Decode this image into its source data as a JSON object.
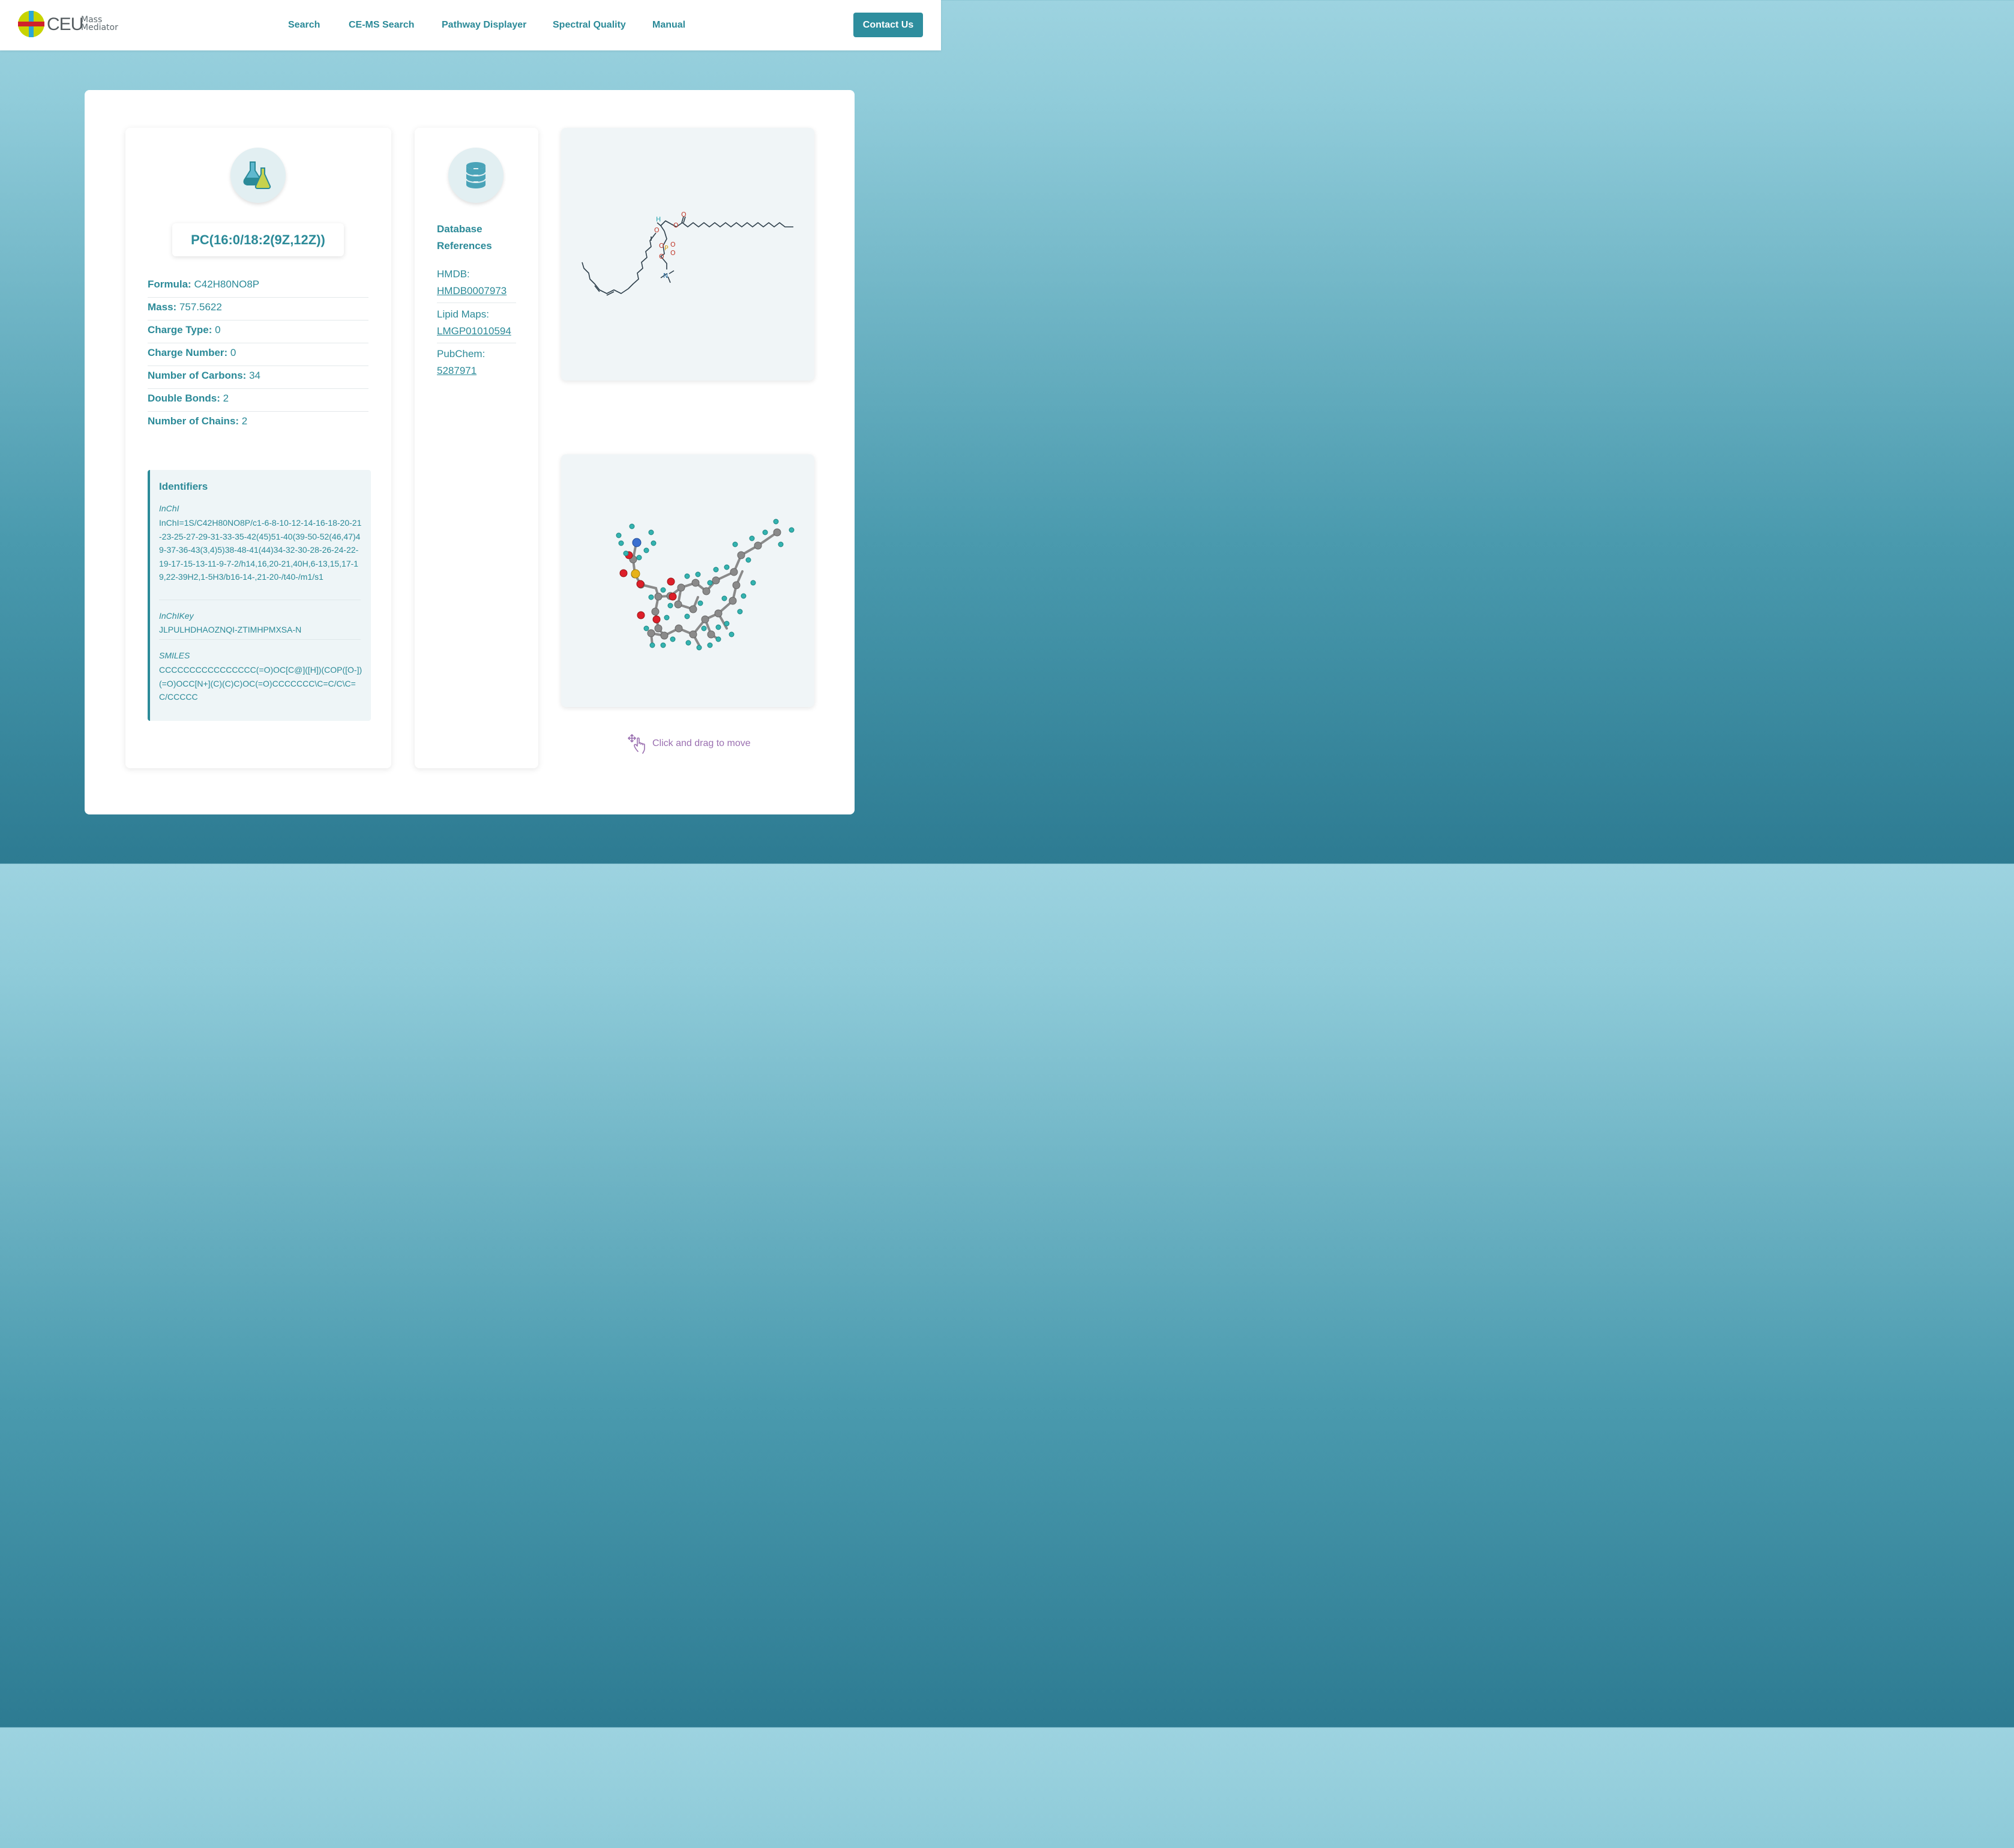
{
  "header": {
    "logo": {
      "main": "CEU",
      "sub_line1": "Mass",
      "sub_line2": "Mediator"
    },
    "nav": [
      "Search",
      "CE-MS Search",
      "Pathway Displayer",
      "Spectral Quality",
      "Manual"
    ],
    "contact_label": "Contact Us",
    "colors": {
      "accent": "#2e8e9e",
      "logo_red": "#d0212b",
      "logo_blue": "#2aa7d8",
      "logo_yellow": "#c8d400"
    }
  },
  "compound": {
    "icon": "flask-icon",
    "name": "PC(16:0/18:2(9Z,12Z))",
    "properties": [
      {
        "key": "Formula:",
        "value": "C42H80NO8P"
      },
      {
        "key": "Mass:",
        "value": "757.5622"
      },
      {
        "key": "Charge Type:",
        "value": "0"
      },
      {
        "key": "Charge Number:",
        "value": "0"
      },
      {
        "key": "Number of Carbons:",
        "value": "34"
      },
      {
        "key": "Double Bonds:",
        "value": "2"
      },
      {
        "key": "Number of Chains:",
        "value": "2"
      }
    ],
    "identifiers": {
      "title": "Identifiers",
      "inchi_label": "InChI",
      "inchi": "InChI=1S/C42H80NO8P/c1-6-8-10-12-14-16-18-20-21-23-25-27-29-31-33-35-42(45)51-40(39-50-52(46,47)49-37-36-43(3,4)5)38-48-41(44)34-32-30-28-26-24-22-19-17-15-13-11-9-7-2/h14,16,20-21,40H,6-13,15,17-19,22-39H2,1-5H3/b16-14-,21-20-/t40-/m1/s1",
      "inchikey_label": "InChIKey",
      "inchikey": "JLPULHDHAOZNQI-ZTIMHPMXSA-N",
      "smiles_label": "SMILES",
      "smiles": "CCCCCCCCCCCCCCCC(=O)OC[C@]([H])(COP([O-])(=O)OCC[N+](C)(C)C)OC(=O)CCCCCCC\\C=C/C\\C=C/CCCCC"
    }
  },
  "database": {
    "icon": "database-icon",
    "title": "Database References",
    "refs": [
      {
        "label": "HMDB:",
        "value": "HMDB0007973"
      },
      {
        "label": "Lipid Maps:",
        "value": "LMGP01010594"
      },
      {
        "label": "PubChem:",
        "value": "5287971"
      }
    ]
  },
  "structure": {
    "atoms_2d": {
      "O": "O",
      "H": "H",
      "P": "P",
      "N": "N"
    },
    "viewer_hint": "Click and drag to move",
    "hint_icon": "drag-hand-icon"
  }
}
